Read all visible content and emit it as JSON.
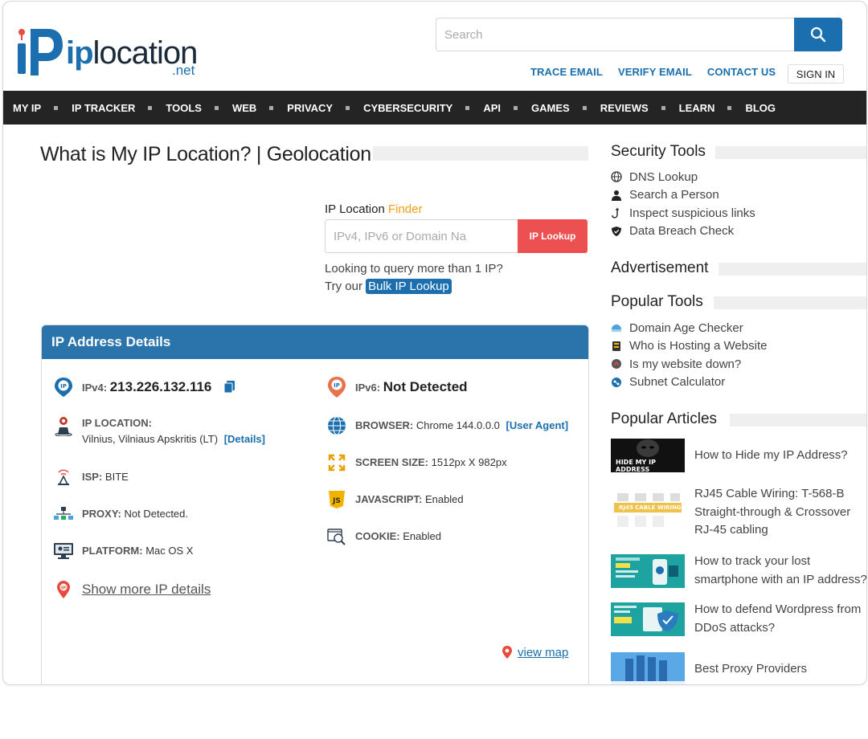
{
  "header": {
    "logo_word_ip": "ip",
    "logo_word_rest": "location",
    "logo_tld": ".net",
    "search_placeholder": "Search",
    "top_links": [
      "TRACE EMAIL",
      "VERIFY EMAIL",
      "CONTACT US"
    ],
    "sign_in": "SIGN IN"
  },
  "nav": [
    "MY IP",
    "IP TRACKER",
    "TOOLS",
    "WEB",
    "PRIVACY",
    "CYBERSECURITY",
    "API",
    "GAMES",
    "REVIEWS",
    "LEARN",
    "BLOG"
  ],
  "main": {
    "title": "What is My IP Location? | Geolocation",
    "finder": {
      "label_main": "IP Location ",
      "label_accent": "Finder",
      "placeholder": "IPv4, IPv6 or Domain Na",
      "button": "IP Lookup",
      "note_line1": "Looking to query more than 1 IP?",
      "note_try": "Try our ",
      "bulk_link": "Bulk IP Lookup"
    },
    "details": {
      "heading": "IP Address Details",
      "ipv4_label": "IPv4:",
      "ipv4_value": "213.226.132.116",
      "ipv6_label": "IPv6:",
      "ipv6_value": "Not Detected",
      "location_label": "IP LOCATION:",
      "location_value": "Vilnius, Vilniaus Apskritis (LT)",
      "location_link": "[Details]",
      "browser_label": "BROWSER:",
      "browser_value": "Chrome 144.0.0.0",
      "browser_link": "[User Agent]",
      "isp_label": "ISP:",
      "isp_value": "BITE",
      "screen_label": "SCREEN SIZE:",
      "screen_value": "1512px X 982px",
      "proxy_label": "PROXY:",
      "proxy_value": "Not Detected.",
      "js_label": "JAVASCRIPT:",
      "js_value": "Enabled",
      "platform_label": "PLATFORM:",
      "platform_value": "Mac OS X",
      "cookie_label": "COOKIE:",
      "cookie_value": "Enabled",
      "show_more": "Show more IP details",
      "view_map": "view map"
    }
  },
  "sidebar": {
    "security_heading": "Security Tools",
    "security_items": [
      "DNS Lookup",
      "Search a Person",
      "Inspect suspicious links",
      "Data Breach Check"
    ],
    "ad_heading": "Advertisement",
    "popular_tools_heading": "Popular Tools",
    "popular_tools": [
      "Domain Age Checker",
      "Who is Hosting a Website",
      "Is my website down?",
      "Subnet Calculator"
    ],
    "articles_heading": "Popular Articles",
    "articles": [
      "How to Hide my IP Address?",
      "RJ45 Cable Wiring: T-568-B Straight-through & Crossover RJ-45 cabling",
      "How to track your lost smartphone with an IP address?",
      "How to defend Wordpress from DDoS attacks?",
      "Best Proxy Providers"
    ],
    "thumb_texts": [
      "HIDE MY IP ADDRESS",
      "RJ45 CABLE WIRING"
    ]
  },
  "colors": {
    "brand_blue": "#1b6fae",
    "panel_head": "#2a73ab",
    "lookup_red": "#ec5050",
    "finder_accent": "#f39c12",
    "nav_bg": "#242424"
  }
}
